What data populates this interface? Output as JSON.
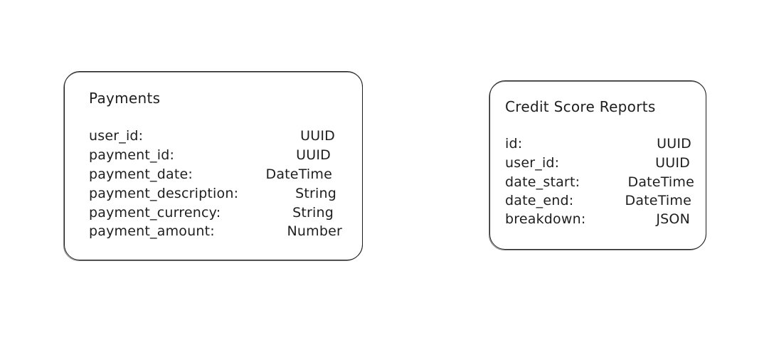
{
  "tables": [
    {
      "title": "Payments",
      "fields": [
        {
          "name": "user_id:",
          "type": "UUID"
        },
        {
          "name": "payment_id:",
          "type": "UUID"
        },
        {
          "name": "payment_date:",
          "type": "DateTime"
        },
        {
          "name": "payment_description:",
          "type": "String"
        },
        {
          "name": "payment_currency:",
          "type": "String"
        },
        {
          "name": "payment_amount:",
          "type": "Number"
        }
      ]
    },
    {
      "title": "Credit Score Reports",
      "fields": [
        {
          "name": "id:",
          "type": "UUID"
        },
        {
          "name": "user_id:",
          "type": "UUID"
        },
        {
          "name": "date_start:",
          "type": "DateTime"
        },
        {
          "name": "date_end:",
          "type": "DateTime"
        },
        {
          "name": "breakdown:",
          "type": "JSON"
        }
      ]
    }
  ]
}
